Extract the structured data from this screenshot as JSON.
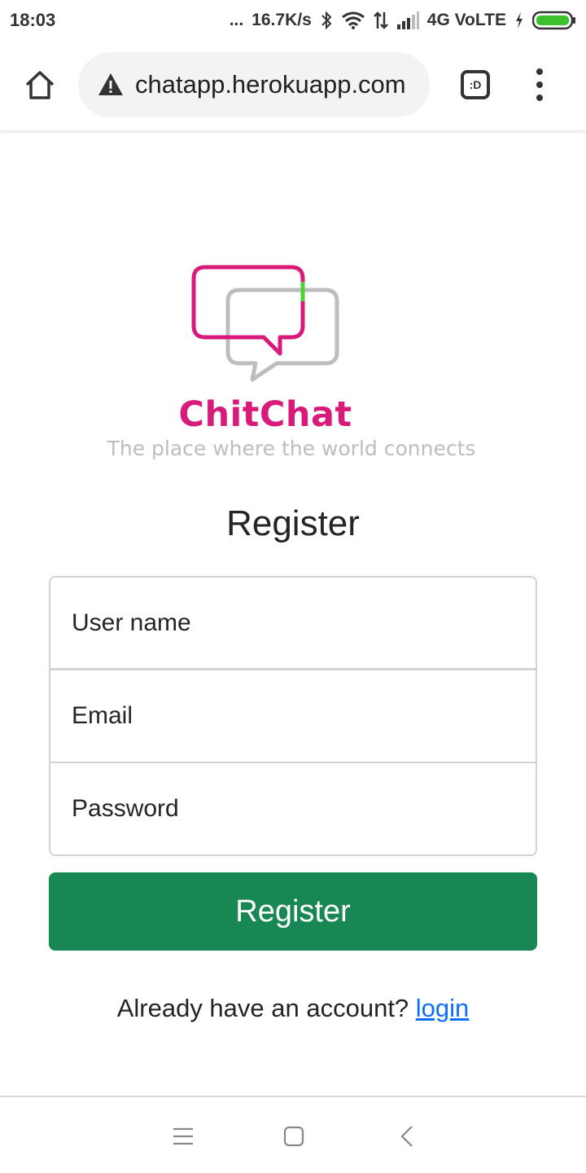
{
  "status_bar": {
    "time": "18:03",
    "dots": "...",
    "net_speed": "16.7K/s",
    "network": "4G VoLTE",
    "icons": [
      "bluetooth-icon",
      "wifi-icon",
      "data-arrows-icon",
      "signal-icon",
      "charging-icon",
      "battery-icon"
    ]
  },
  "browser": {
    "url": "chatapp.herokuapp.com",
    "tab_label": ":D",
    "icons": [
      "home-icon",
      "warning-icon",
      "tab-switcher-icon",
      "menu-icon"
    ]
  },
  "logo": {
    "name": "ChitChat",
    "tagline": "The place where the world connects",
    "colors": {
      "primary": "#d81b7a",
      "secondary": "#bdbdbd",
      "accent": "#4cd137"
    }
  },
  "form": {
    "title": "Register",
    "username_placeholder": "User name",
    "email_placeholder": "Email",
    "password_placeholder": "Password",
    "submit_label": "Register",
    "login_prompt": "Already have an account?",
    "login_link": "login"
  },
  "colors": {
    "button": "#198754",
    "link": "#0d6efd"
  },
  "nav_bar": {
    "icons": [
      "menu-lines-icon",
      "home-square-icon",
      "back-icon"
    ]
  }
}
